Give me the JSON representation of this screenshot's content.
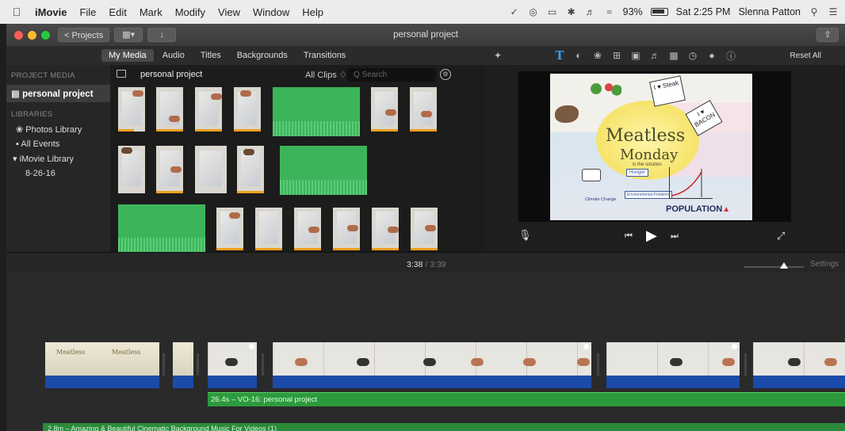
{
  "menubar": {
    "app_name": "iMovie",
    "items": [
      "File",
      "Edit",
      "Mark",
      "Modify",
      "View",
      "Window",
      "Help"
    ],
    "battery": "93%",
    "clock": "Sat 2:25 PM",
    "user": "Slenna Patton"
  },
  "toolbar": {
    "projects_label": "< Projects",
    "window_title": "personal project"
  },
  "browser": {
    "tabs": [
      "My Media",
      "Audio",
      "Titles",
      "Backgrounds",
      "Transitions"
    ],
    "active_tab": "My Media",
    "project_name": "personal project",
    "filter": "All Clips ♢",
    "search_placeholder": "Q Search"
  },
  "viewer_tools": {
    "reset_all": "Reset All"
  },
  "sidebar": {
    "project_media_header": "PROJECT MEDIA",
    "project": "personal project",
    "libraries_header": "LIBRARIES",
    "items": [
      "Photos Library",
      "All Events",
      "▾ iMovie Library",
      "8-26-16"
    ]
  },
  "poster": {
    "title1": "Meatless",
    "title2": "Monday",
    "subtitle": "is the solution",
    "steak": "I ♥ Steak",
    "bacon": "I ♥ BACON",
    "population": "POPULATION",
    "hunger": "Hunger",
    "environment": "Environmental Problems",
    "climate": "Climate Change"
  },
  "timeline": {
    "current_time": "3:38",
    "separator": " / ",
    "total_time": "3:39",
    "settings": "Settings",
    "vo_label": "26.4s – VO-16: personal project",
    "music_label": "2.8m – Amazing & Beautiful Cinematic Background Music For Videos (1)"
  },
  "colors": {
    "accent_blue": "#3b9cf5",
    "audio_green": "#3cb55a",
    "clip_audio_blue": "#1c4aa8",
    "clip_used_orange": "#f0a020"
  }
}
